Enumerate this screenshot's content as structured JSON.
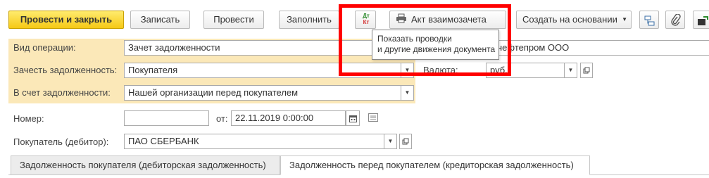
{
  "toolbar": {
    "post_close": "Провести и закрыть",
    "save": "Записать",
    "post": "Провести",
    "fill": "Заполнить",
    "dtkt_top": "Дт",
    "dtkt_bottom": "Кт",
    "act": "Акт взаимозачета",
    "create_based": "Создать на основании"
  },
  "tooltip": {
    "line1": "Показать проводки",
    "line2": "и другие движения документа"
  },
  "form": {
    "operation_label": "Вид операции:",
    "operation_value": "Зачет задолженности",
    "counterparty_partial": "нефтепром ООО",
    "offset_label": "Зачесть задолженность:",
    "offset_value": "Покупателя",
    "currency_label": "Валюта:",
    "currency_value": "руб.",
    "against_label": "В счет задолженности:",
    "against_value": "Нашей организации перед покупателем",
    "number_label": "Номер:",
    "number_value": "",
    "from_label": "от:",
    "date_value": "22.11.2019  0:00:00",
    "buyer_label": "Покупатель (дебитор):",
    "buyer_value": "ПАО СБЕРБАНК"
  },
  "tabs": [
    {
      "label": "Задолженность покупателя (дебиторская задолженность)"
    },
    {
      "label": "Задолженность перед покупателем (кредиторская задолженность)"
    }
  ],
  "colors": {
    "primary_button": "#f6c915",
    "highlight_panel": "#fbe8b8",
    "annotation_frame": "#ff0000"
  }
}
